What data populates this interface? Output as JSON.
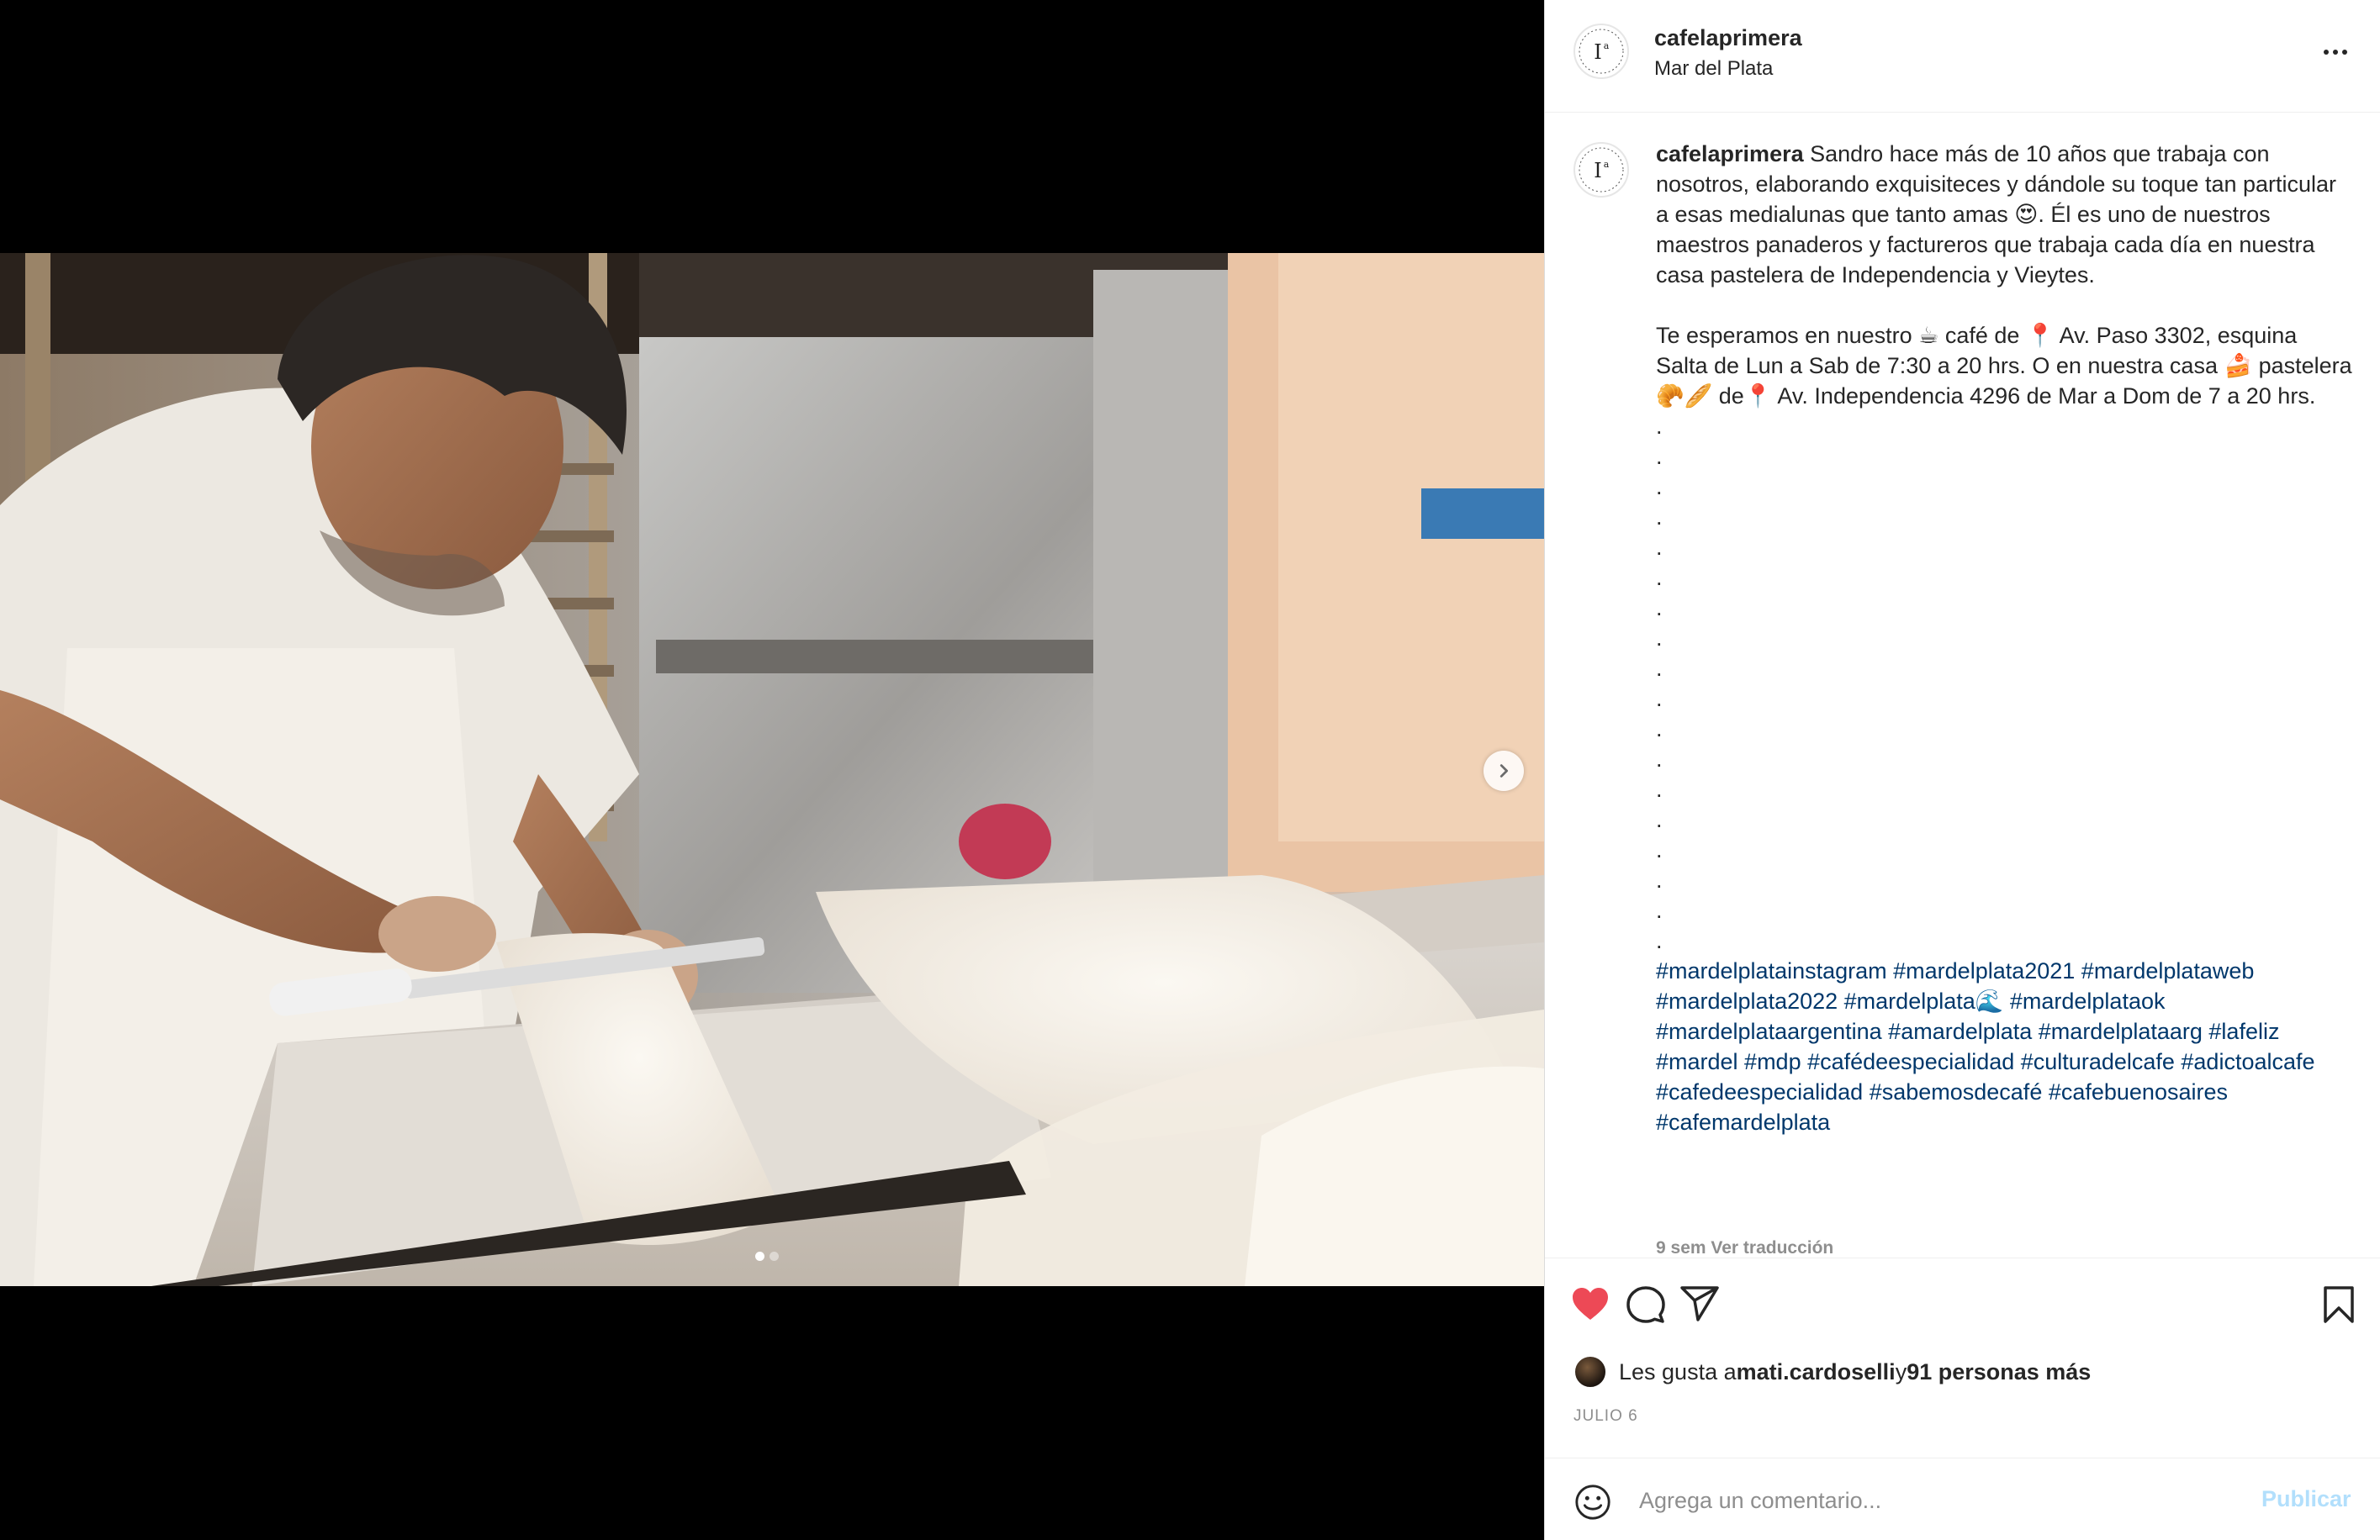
{
  "post": {
    "username": "cafelaprimera",
    "location": "Mar del Plata",
    "avatar_text": "1ª"
  },
  "caption": {
    "username": "cafelaprimera",
    "para1": " Sandro hace más de 10 años que trabaja con nosotros, elaborando exquisiteces y dándole su toque tan particular a esas medialunas que tanto amas 😍. Él es uno de nuestros maestros panaderos y factureros que trabaja cada día en nuestra casa pastelera de Independencia y Vieytes.",
    "para2": "Te esperamos en nuestro ☕ café de 📍 Av. Paso 3302, esquina Salta de Lun a Sab de 7:30 a 20 hrs. O en nuestra casa 🍰 pastelera 🥐🥖 de📍 Av. Independencia 4296 de Mar a Dom de 7 a 20 hrs.",
    "dots": ".\n.\n.\n.\n.\n.\n.\n.\n.\n.\n.\n.\n.\n.\n.\n.\n.\n.",
    "hashtags": "#mardelplatainstagram #mardelplata2021 #mardelplataweb #mardelplata2022 #mardelplata🌊 #mardelplataok #mardelplataargentina #amardelplata #mardelplataarg #lafeliz #mardel #mdp #cafédeespecialidad #culturadelcafe #adictoalcafe #cafedeespecialidad #sabemosdecafé #cafebuenosaires #cafemardelplata",
    "footer": "9 sem   Ver traducción"
  },
  "likes": {
    "prefix": "Les gusta a ",
    "user": "mati.cardoselli",
    "middle": " y ",
    "others": "91 personas más"
  },
  "date": "JULIO 6",
  "comment": {
    "placeholder": "Agrega un comentario...",
    "publish": "Publicar"
  },
  "carousel": {
    "current": 1,
    "total": 2
  },
  "icons": {
    "like": "heart-icon",
    "comment": "comment-icon",
    "share": "share-icon",
    "save": "bookmark-icon",
    "emoji": "emoji-icon",
    "more": "more-icon",
    "next": "chevron-right-icon"
  },
  "colors": {
    "like_red": "#ed4956",
    "hashtag_blue": "#00376b",
    "publish_disabled": "#b2dffc",
    "muted": "#8e8e8e"
  }
}
